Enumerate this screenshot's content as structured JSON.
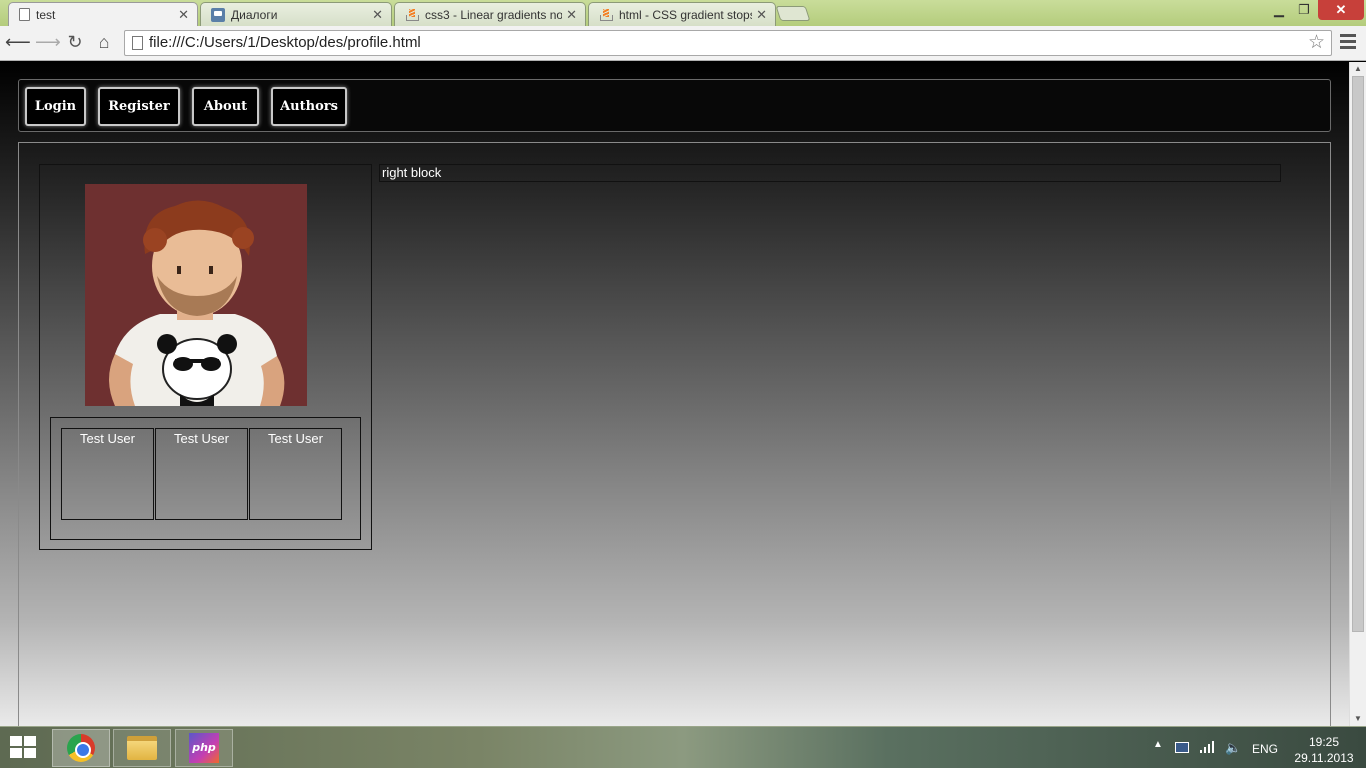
{
  "browser": {
    "tabs": [
      {
        "title": "test",
        "favicon": "page-icon",
        "active": true
      },
      {
        "title": "Диалоги",
        "favicon": "chat-icon"
      },
      {
        "title": "css3 - Linear gradients not",
        "favicon": "stackoverflow-icon"
      },
      {
        "title": "html - CSS gradient stops",
        "favicon": "stackoverflow-icon"
      }
    ],
    "address": "file:///C:/Users/1/Desktop/des/profile.html"
  },
  "page": {
    "nav": [
      "Login",
      "Register",
      "About",
      "Authors"
    ],
    "friends": [
      "Test User",
      "Test User",
      "Test User"
    ],
    "right_block": "right block"
  },
  "taskbar": {
    "apps": [
      "chrome",
      "file-explorer",
      "phpstorm"
    ],
    "language": "ENG",
    "time": "19:25",
    "date": "29.11.2013"
  },
  "colors": {
    "tab_bar": "#b4cc7c",
    "avatar_background": "#6e3030",
    "close_button": "#c7403a"
  }
}
